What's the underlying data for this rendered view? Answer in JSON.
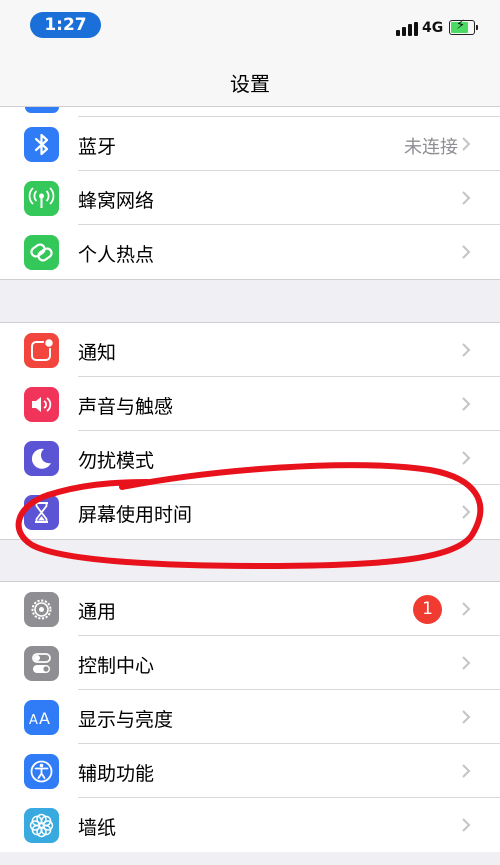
{
  "status_bar": {
    "time": "1:27",
    "network": "4G"
  },
  "nav": {
    "title": "设置"
  },
  "groups": [
    {
      "rows": [
        {
          "label": "蓝牙",
          "value": "未连接",
          "icon": "bluetooth-icon",
          "color": "#2f7cf6"
        },
        {
          "label": "蜂窝网络",
          "icon": "cellular-antenna-icon",
          "color": "#34c759"
        },
        {
          "label": "个人热点",
          "icon": "hotspot-link-icon",
          "color": "#34c759"
        }
      ]
    },
    {
      "rows": [
        {
          "label": "通知",
          "icon": "notifications-icon",
          "color": "#f1453d"
        },
        {
          "label": "声音与触感",
          "icon": "speaker-icon",
          "color": "#f1355a"
        },
        {
          "label": "勿扰模式",
          "icon": "moon-icon",
          "color": "#5b55d6"
        },
        {
          "label": "屏幕使用时间",
          "icon": "hourglass-icon",
          "color": "#5b55d6"
        }
      ]
    },
    {
      "rows": [
        {
          "label": "通用",
          "badge": "1",
          "icon": "gear-icon",
          "color": "#8e8e93"
        },
        {
          "label": "控制中心",
          "icon": "toggles-icon",
          "color": "#8e8e93"
        },
        {
          "label": "显示与亮度",
          "icon": "text-size-icon",
          "color": "#2f7cf6"
        },
        {
          "label": "辅助功能",
          "icon": "accessibility-icon",
          "color": "#2f7cf6"
        },
        {
          "label": "墙纸",
          "icon": "wallpaper-flower-icon",
          "color": "#38aadf"
        }
      ]
    }
  ],
  "annotation": {
    "color": "#e8121c"
  }
}
